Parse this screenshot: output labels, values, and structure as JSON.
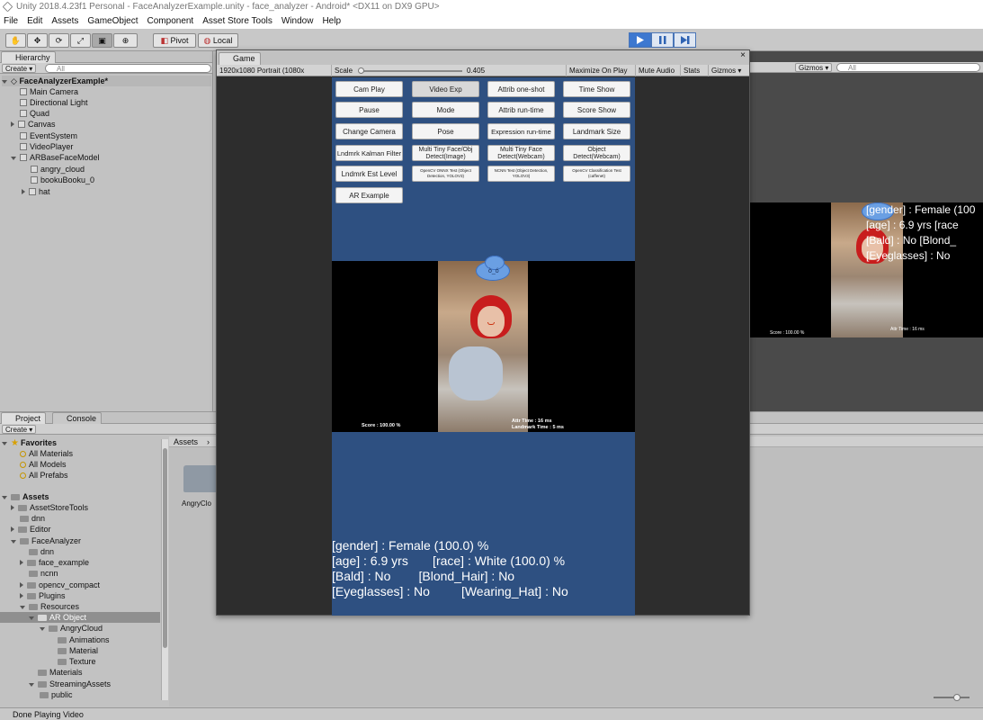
{
  "window": {
    "title": "Unity 2018.4.23f1 Personal - FaceAnalyzerExample.unity - face_analyzer - Android* <DX11 on DX9 GPU>"
  },
  "menu": [
    "File",
    "Edit",
    "Assets",
    "GameObject",
    "Component",
    "Asset Store Tools",
    "Window",
    "Help"
  ],
  "toolbar": {
    "pivot": "Pivot",
    "local": "Local"
  },
  "hierarchy": {
    "tab": "Hierarchy",
    "create": "Create",
    "search_placeholder": "All",
    "scene": "FaceAnalyzerExample*",
    "items": [
      "Main Camera",
      "Directional Light",
      "Quad",
      "Canvas",
      "EventSystem",
      "VideoPlayer",
      "ARBaseFaceModel",
      "angry_cloud",
      "bookuBooku_0",
      "hat"
    ]
  },
  "project": {
    "tab": "Project",
    "console_tab": "Console",
    "create": "Create",
    "favorites": "Favorites",
    "favorite_items": [
      "All Materials",
      "All Models",
      "All Prefabs"
    ],
    "assets": "Assets",
    "tree": [
      "AssetStoreTools",
      "dnn",
      "Editor",
      "FaceAnalyzer",
      "dnn",
      "face_example",
      "ncnn",
      "opencv_compact",
      "Plugins",
      "Resources",
      "AR Object",
      "AngryCloud",
      "Animations",
      "Material",
      "Texture",
      "Materials",
      "StreamingAssets",
      "public"
    ],
    "breadcrumb": "Assets",
    "folder_label": "AngryClo"
  },
  "scene_view": {
    "gizmos": "Gizmos",
    "search_placeholder": "All",
    "overlay": [
      "[gender] : Female (100",
      "[age] : 6.9 yrs      [race",
      "[Bald] : No       [Blond_",
      "[Eyeglasses] : No"
    ],
    "score": "Score : 100.00 %",
    "time": "Attr Time : 16 ms"
  },
  "game": {
    "tab": "Game",
    "resolution": "1920x1080 Portrait (1080x",
    "scale_label": "Scale",
    "scale_value": "0.405",
    "maximize": "Maximize On Play",
    "mute": "Mute Audio",
    "stats": "Stats",
    "gizmos": "Gizmos",
    "buttons": [
      [
        "Cam Play",
        "Video Exp",
        "Attrib one-shot",
        "Time Show"
      ],
      [
        "Pause",
        "Mode",
        "Attrib run-time",
        "Score Show"
      ],
      [
        "Change Camera",
        "Pose",
        "Expression run-time",
        "Landmark Size"
      ],
      [
        "Lndmrk Kalman Filter",
        "Multi Tiny Face/Obj Detect(Image)",
        "Multi Tiny Face Detect(Webcam)",
        "Object Detect(Webcam)"
      ],
      [
        "Lndmrk Est Level",
        "OpenCV ONNX Test (Object Detection, YOLOV3)",
        "NCNN Test (Object Detection, YOLOV3)",
        "OpenCV Classification Test (caffenet)"
      ],
      [
        "AR Example"
      ]
    ],
    "score": "Score : 100.00 %",
    "attr_time": "Attr Time : 16 ms",
    "landmark_time": "Landmark Time : 5 ms",
    "result_lines": [
      "[gender] : Female (100.0) %",
      "[age] : 6.9 yrs       [race] : White (100.0) %",
      "[Bald] : No        [Blond_Hair] : No",
      "[Eyeglasses] : No         [Wearing_Hat] : No"
    ]
  },
  "status": "Done Playing Video"
}
